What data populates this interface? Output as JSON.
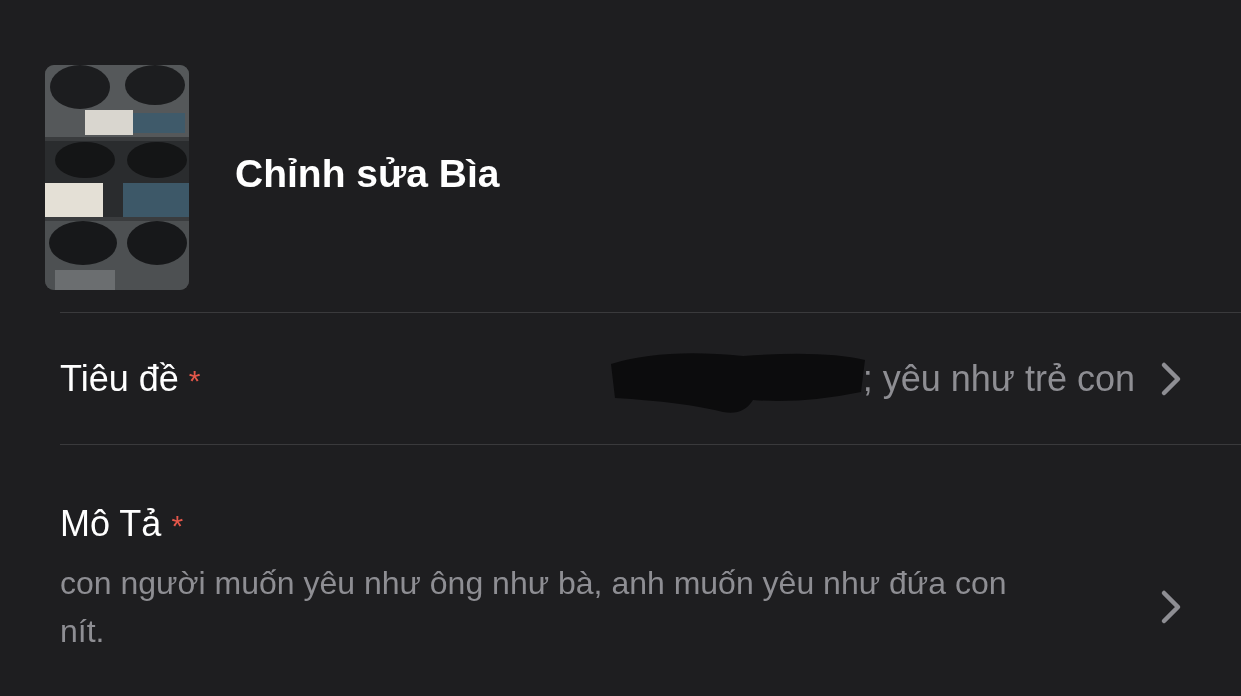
{
  "header": {
    "title": "Chỉnh sửa Bìa"
  },
  "fields": [
    {
      "kind": "inline",
      "label": "Tiêu đề",
      "required_mark": "*",
      "redacted": true,
      "value": "; yêu như trẻ con"
    },
    {
      "kind": "stacked",
      "label": "Mô Tả",
      "required_mark": "*",
      "value": "con người muốn yêu như ông như bà, anh muốn yêu như đứa con nít."
    }
  ]
}
